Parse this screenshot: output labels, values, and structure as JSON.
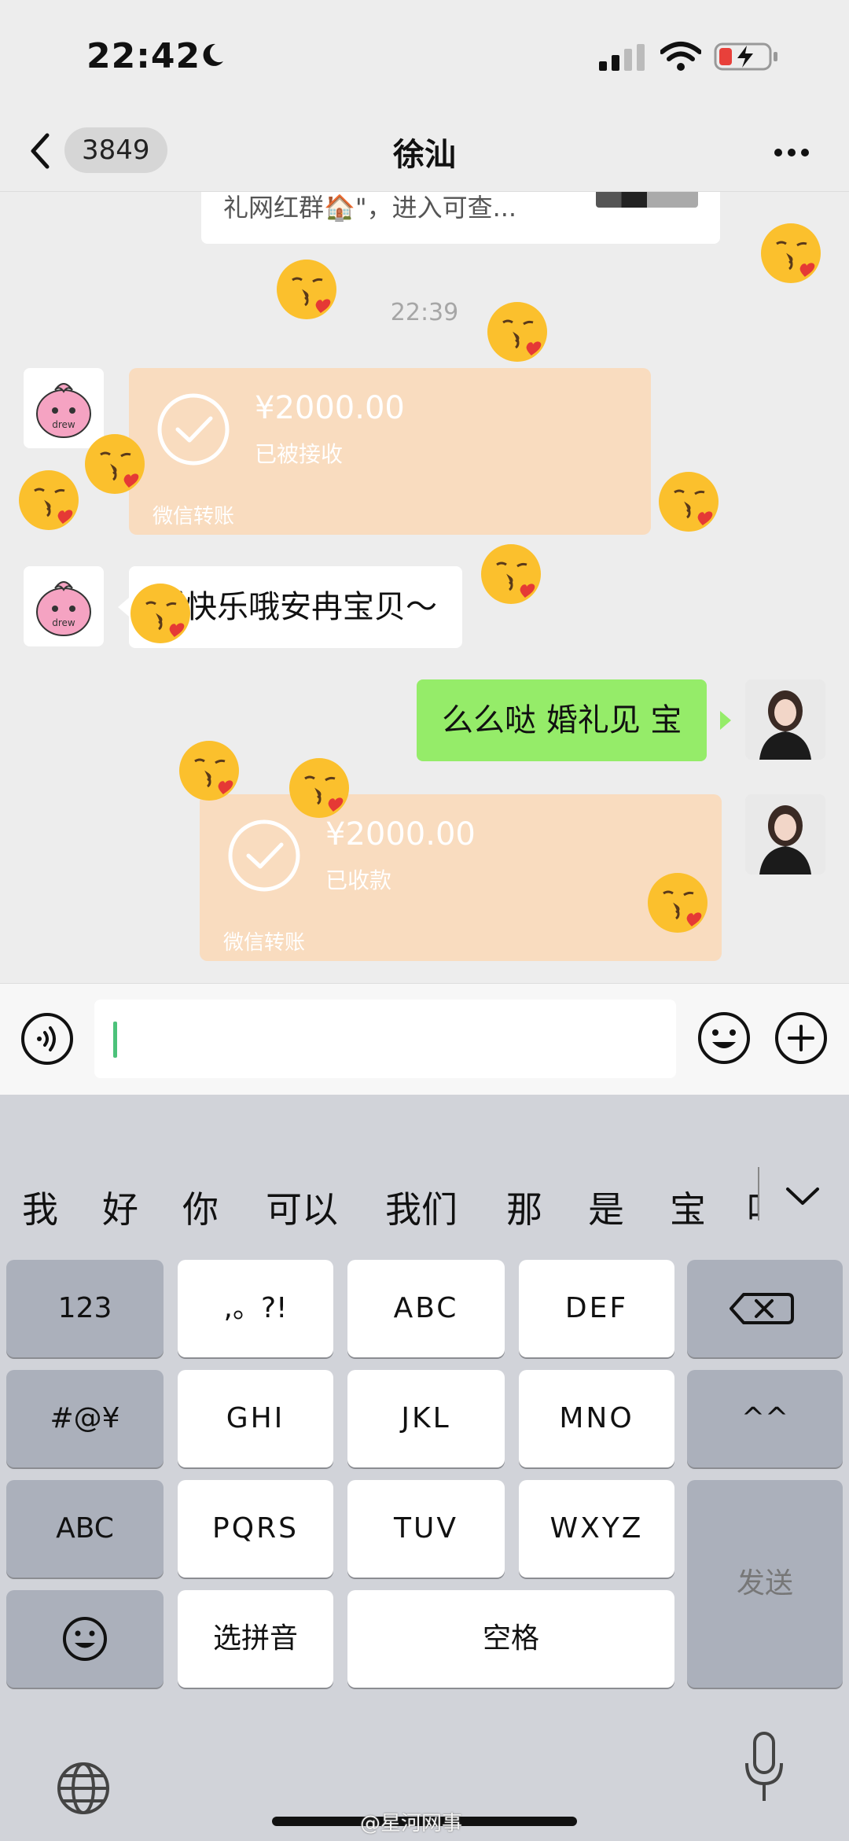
{
  "status_bar": {
    "time": "22:42",
    "icons": [
      "moon-icon",
      "signal-icon",
      "wifi-icon",
      "battery-charging-icon"
    ]
  },
  "nav": {
    "back_icon": "chevron-left-icon",
    "unread_count": "3849",
    "title": "徐汕",
    "more_icon": "ellipsis-icon"
  },
  "chat": {
    "top_card_text": "礼网红群🏠\"，进入可查...",
    "timestamp": "22:39",
    "messages": [
      {
        "type": "transfer",
        "side": "left",
        "amount": "¥2000.00",
        "state": "已被接收",
        "footer": "微信转账"
      },
      {
        "type": "text",
        "side": "left",
        "text": "婚快乐哦安冉宝贝～"
      },
      {
        "type": "text",
        "side": "right",
        "text": "么么哒 婚礼见 宝"
      },
      {
        "type": "transfer",
        "side": "right",
        "amount": "¥2000.00",
        "state": "已收款",
        "footer": "微信转账"
      }
    ],
    "overlay_emoji": "kissing-heart-emoji"
  },
  "input_bar": {
    "voice_icon": "voice-icon",
    "text_value": "",
    "emoji_icon": "smile-icon",
    "plus_icon": "plus-icon"
  },
  "keyboard": {
    "candidates": [
      "我",
      "好",
      "你",
      "可以",
      "我们",
      "那",
      "是",
      "宝",
      "吖"
    ],
    "collapse_icon": "chevron-down-icon",
    "rows": [
      [
        "123",
        ",。?!",
        "ABC",
        "DEF"
      ],
      [
        "#@¥",
        "GHI",
        "JKL",
        "MNO",
        "^^"
      ],
      [
        "ABC",
        "PQRS",
        "TUV",
        "WXYZ"
      ],
      [
        "选拼音",
        "空格"
      ]
    ],
    "send_label": "发送",
    "emoji_key_icon": "smile-key-icon",
    "backspace_icon": "backspace-icon",
    "globe_icon": "globe-icon",
    "mic_icon": "microphone-icon"
  },
  "watermark": "@星河网事",
  "colors": {
    "transfer_bg": "#f9dcbf",
    "sent_bubble": "#95ec69",
    "chat_bg": "#ededed",
    "keyboard_bg": "#d1d3d9"
  }
}
